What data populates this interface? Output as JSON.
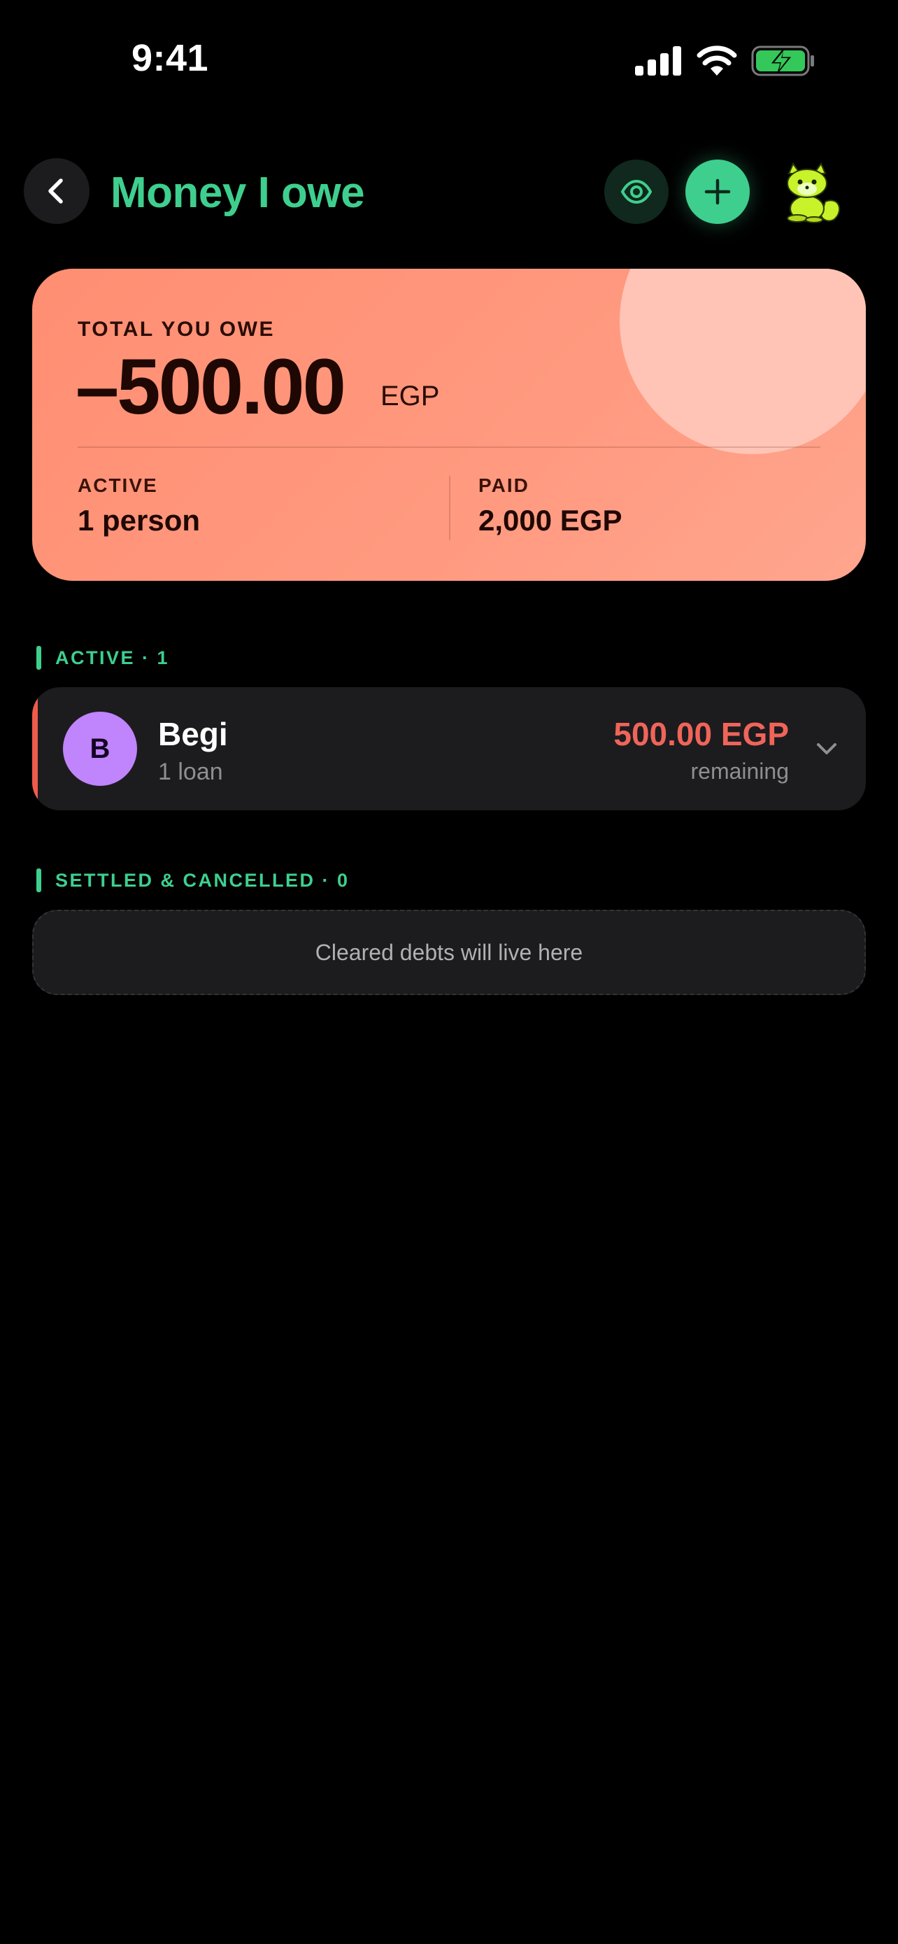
{
  "status_bar": {
    "time": "9:41",
    "icons": [
      "signal-icon",
      "wifi-icon",
      "battery-charging-icon"
    ]
  },
  "header": {
    "title": "Money I owe",
    "back_icon": "chevron-left-icon",
    "eye_icon": "eye-icon",
    "add_icon": "plus-icon",
    "mascot": "fox-mascot-icon"
  },
  "summary": {
    "label": "TOTAL YOU OWE",
    "amount": "–500.00",
    "currency": "EGP",
    "stats": [
      {
        "label": "ACTIVE",
        "value": "1 person"
      },
      {
        "label": "PAID",
        "value": "2,000 EGP"
      }
    ]
  },
  "sections": {
    "active": {
      "heading": "ACTIVE · 1"
    },
    "settled": {
      "heading": "SETTLED & CANCELLED · 0",
      "empty_text": "Cleared debts will live here"
    }
  },
  "loans": [
    {
      "initial": "B",
      "name": "Begi",
      "count": "1 loan",
      "amount": "500.00 EGP",
      "sub": "remaining"
    }
  ],
  "colors": {
    "accent_green": "#3ecf8e",
    "card_coral": "#ff8e72",
    "debt_red": "#f0645a",
    "avatar_purple": "#c084fc",
    "background": "#000000"
  }
}
